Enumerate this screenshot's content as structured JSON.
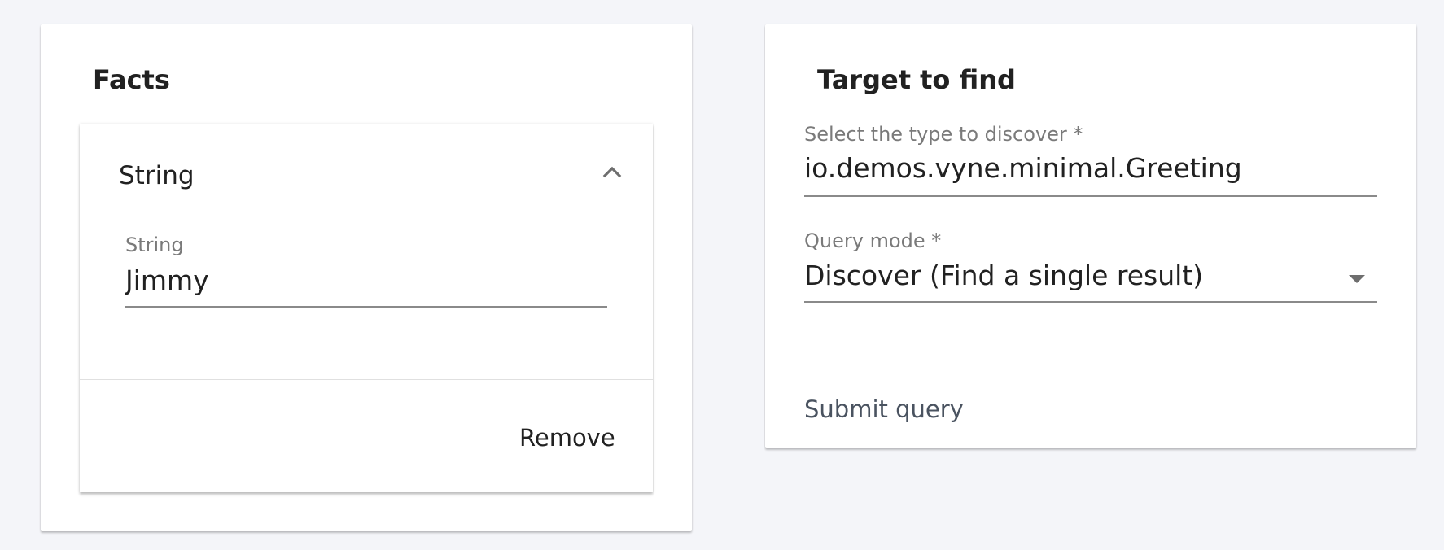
{
  "facts": {
    "title": "Facts",
    "panel": {
      "header_title": "String",
      "expanded": true,
      "field_label": "String",
      "field_value": "Jimmy",
      "remove_label": "Remove",
      "chevron_icon": "chevron-up-icon"
    }
  },
  "target": {
    "title": "Target to find",
    "type_field": {
      "label": "Select the type to discover *",
      "value": "io.demos.vyne.minimal.Greeting"
    },
    "query_mode": {
      "label": "Query mode *",
      "selected": "Discover (Find a single result)",
      "dropdown_icon": "caret-down-icon"
    },
    "submit_label": "Submit query"
  },
  "colors": {
    "background": "#f4f5f9",
    "card": "#ffffff",
    "text_primary": "#212121",
    "text_label": "#7a7a7a",
    "submit_text": "#4a5360"
  }
}
